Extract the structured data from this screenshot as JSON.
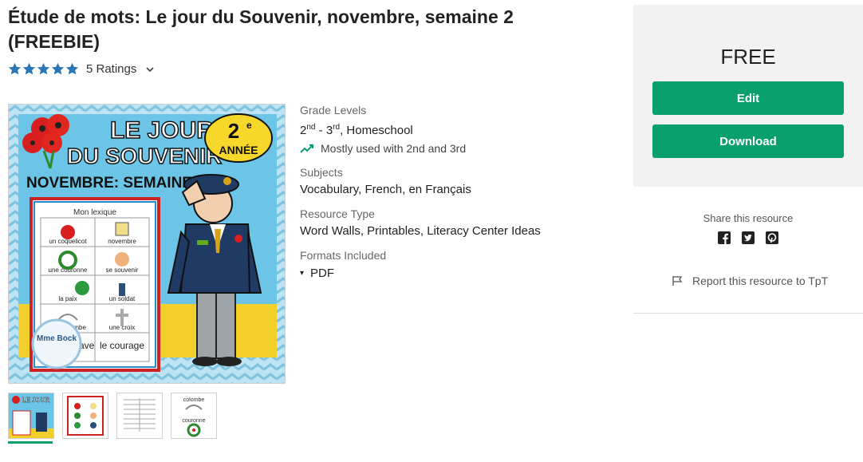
{
  "product": {
    "title": "Étude de mots: Le jour du Souvenir, novembre, semaine 2 (FREEBIE)",
    "rating_text": "5 Ratings",
    "stars": 5
  },
  "cover": {
    "line1": "LE JOUR",
    "line2": "DU SOUVENIR",
    "grade_num": "2",
    "grade_sup": "e",
    "grade_word": "ANNÉE",
    "banner": "NOVEMBRE: SEMAINE 2",
    "lexique_title": "Mon lexique",
    "words": [
      "un coquelicot",
      "novembre",
      "une couronne",
      "se souvenir",
      "la paix",
      "un soldat",
      "une colombe",
      "une croix",
      "la brave",
      "le courage"
    ],
    "badge": "Mme Bock"
  },
  "thumbnails": [
    {
      "name": "thumb-cover",
      "caption": "LE JOUR"
    },
    {
      "name": "thumb-lexique",
      "caption": ""
    },
    {
      "name": "thumb-worksheet",
      "caption": ""
    },
    {
      "name": "thumb-wordwall",
      "caption_top": "colombe",
      "caption_bottom": "couronne"
    }
  ],
  "details": {
    "grade_label": "Grade Levels",
    "grade_a": "2",
    "grade_a_sup": "nd",
    "grade_sep": " - ",
    "grade_b": "3",
    "grade_b_sup": "rd",
    "grade_rest": ", Homeschool",
    "trend_text": "Mostly used with 2nd and 3rd",
    "subjects_label": "Subjects",
    "subjects_value": "Vocabulary, French, en Français",
    "type_label": "Resource Type",
    "type_value": "Word Walls, Printables, Literacy Center Ideas",
    "formats_label": "Formats Included",
    "format_value": "PDF"
  },
  "purchase": {
    "price": "FREE",
    "edit_label": "Edit",
    "download_label": "Download"
  },
  "share": {
    "label": "Share this resource",
    "report_text": "Report this resource to TpT",
    "icons": [
      "facebook-icon",
      "twitter-icon",
      "pinterest-icon"
    ]
  },
  "colors": {
    "accent_green": "#0aa06e",
    "star_blue": "#2a78b8"
  }
}
